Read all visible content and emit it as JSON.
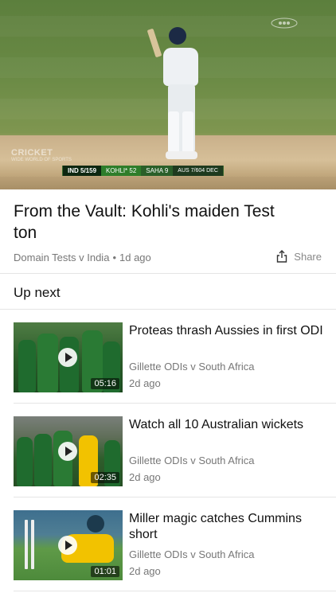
{
  "video": {
    "brand": "CRICKET",
    "brand_sub": "WIDE WORLD OF SPORTS",
    "channel_logo": "9",
    "scorebar": {
      "team": "IND  5/159",
      "batter": "KOHLI* 52",
      "partner": "SAHA  9",
      "opponent": "AUS 7/604 DEC"
    }
  },
  "article": {
    "title": "From the Vault: Kohli's maiden Test ton",
    "category": "Domain Tests v India",
    "separator": "•",
    "age": "1d ago",
    "share_label": "Share"
  },
  "up_next": {
    "heading": "Up next",
    "items": [
      {
        "title": "Proteas thrash Aussies in first ODI",
        "series": "Gillette ODIs v South Africa",
        "age": "2d ago",
        "duration": "05:16",
        "thumb_color": "#2f6b2b"
      },
      {
        "title": "Watch all 10 Australian wickets",
        "series": "Gillette ODIs v South Africa",
        "age": "2d ago",
        "duration": "02:35",
        "thumb_color": "#3b6f34"
      },
      {
        "title": "Miller magic catches Cummins short",
        "series": "Gillette ODIs v South Africa",
        "age": "2d ago",
        "duration": "01:01",
        "thumb_color": "#4f8a3c"
      }
    ]
  },
  "colors": {
    "text_primary": "#111111",
    "text_secondary": "#777777",
    "divider": "#e5e5e5",
    "sa_green": "#1f6b2e",
    "aus_yellow": "#f2c200"
  }
}
